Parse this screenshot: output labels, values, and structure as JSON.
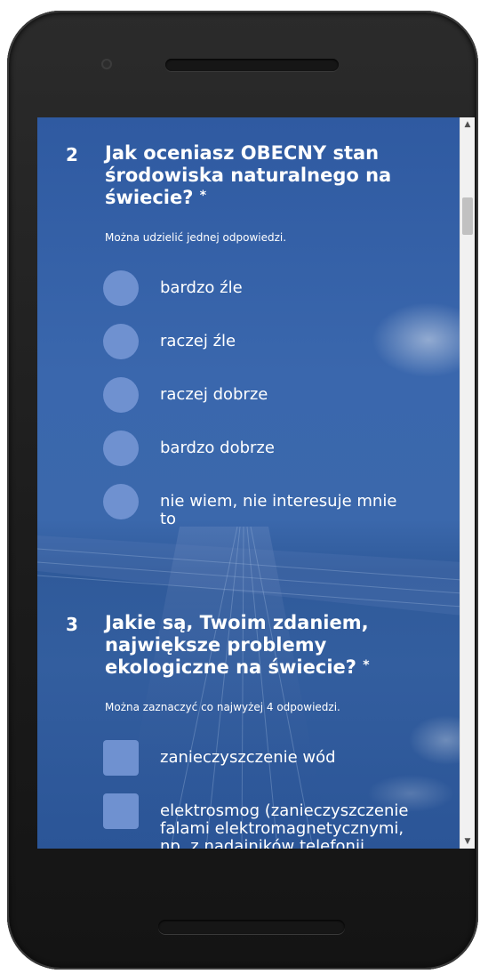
{
  "questions": [
    {
      "number": "2",
      "title": "Jak oceniasz OBECNY stan środowiska naturalnego na świecie?",
      "required_mark": "*",
      "hint": "Można udzielić jednej odpowiedzi.",
      "input_type": "radio",
      "options": [
        {
          "label": "bardzo źle"
        },
        {
          "label": "raczej źle"
        },
        {
          "label": "raczej dobrze"
        },
        {
          "label": "bardzo dobrze"
        },
        {
          "label": "nie wiem, nie interesuje mnie to"
        }
      ]
    },
    {
      "number": "3",
      "title": "Jakie są, Twoim zdaniem, największe problemy ekologiczne na świecie?",
      "required_mark": "*",
      "hint": "Można zaznaczyć co najwyżej 4 odpowiedzi.",
      "input_type": "checkbox",
      "options": [
        {
          "label": "zanieczyszczenie wód"
        },
        {
          "label": "elektrosmog (zanieczyszczenie falami elektromagnetycznymi, np. z nadajników telefonii komórkowej)"
        }
      ]
    }
  ],
  "scrollbar": {
    "up_icon": "triangle-up",
    "down_icon": "triangle-down"
  },
  "colors": {
    "background": "#3a67ad",
    "option_fill": "#6f91d0",
    "text": "#ffffff"
  }
}
